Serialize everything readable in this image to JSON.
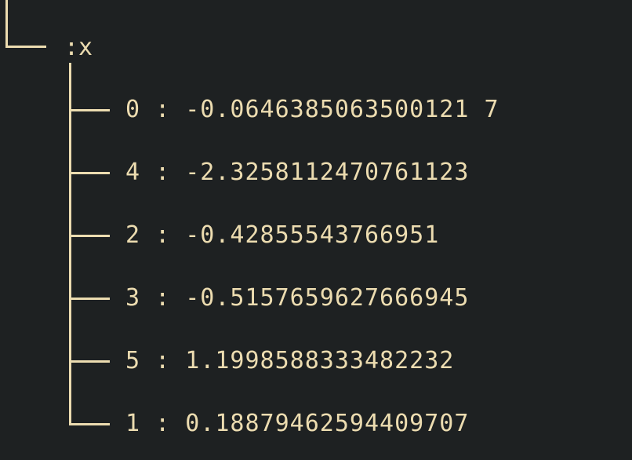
{
  "node": {
    "key": ":x",
    "children": [
      {
        "index": "0",
        "sep": " : ",
        "value": "-0.0646385063500121 7"
      },
      {
        "index": "4",
        "sep": " : ",
        "value": "-2.3258112470761123"
      },
      {
        "index": "2",
        "sep": " : ",
        "value": "-0.42855543766951"
      },
      {
        "index": "3",
        "sep": " : ",
        "value": "-0.5157659627666945"
      },
      {
        "index": "5",
        "sep": " : ",
        "value": "1.1998588333482232"
      },
      {
        "index": "1",
        "sep": " : ",
        "value": "0.18879462594409707"
      }
    ]
  },
  "colors": {
    "background": "#1e2122",
    "foreground": "#ecdcb0"
  }
}
